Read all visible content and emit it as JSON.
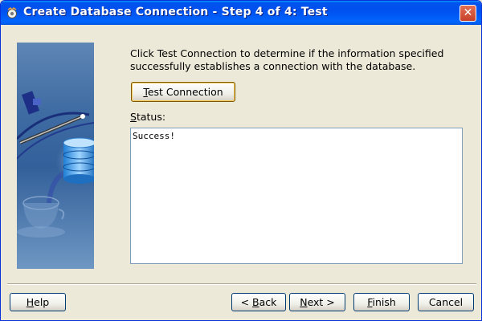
{
  "window": {
    "title": "Create Database Connection - Step 4 of 4: Test",
    "close_label": "✕"
  },
  "content": {
    "description": "Click Test Connection to determine if the information specified successfully establishes a connection with the database.",
    "test_button": {
      "mnemonic": "T",
      "rest": "est Connection"
    },
    "status_label": {
      "mnemonic": "S",
      "rest": "tatus:"
    },
    "status_text": "Success!"
  },
  "footer": {
    "help": {
      "mnemonic": "H",
      "rest": "elp"
    },
    "back": {
      "prefix": "< ",
      "mnemonic": "B",
      "rest": "ack"
    },
    "next": {
      "mnemonic": "N",
      "rest": "ext >"
    },
    "finish": {
      "mnemonic": "F",
      "rest": "inish"
    },
    "cancel": "Cancel"
  },
  "colors": {
    "titlebar": "#0053EE",
    "close": "#C7402A",
    "dialog_bg": "#ECE9D8"
  }
}
